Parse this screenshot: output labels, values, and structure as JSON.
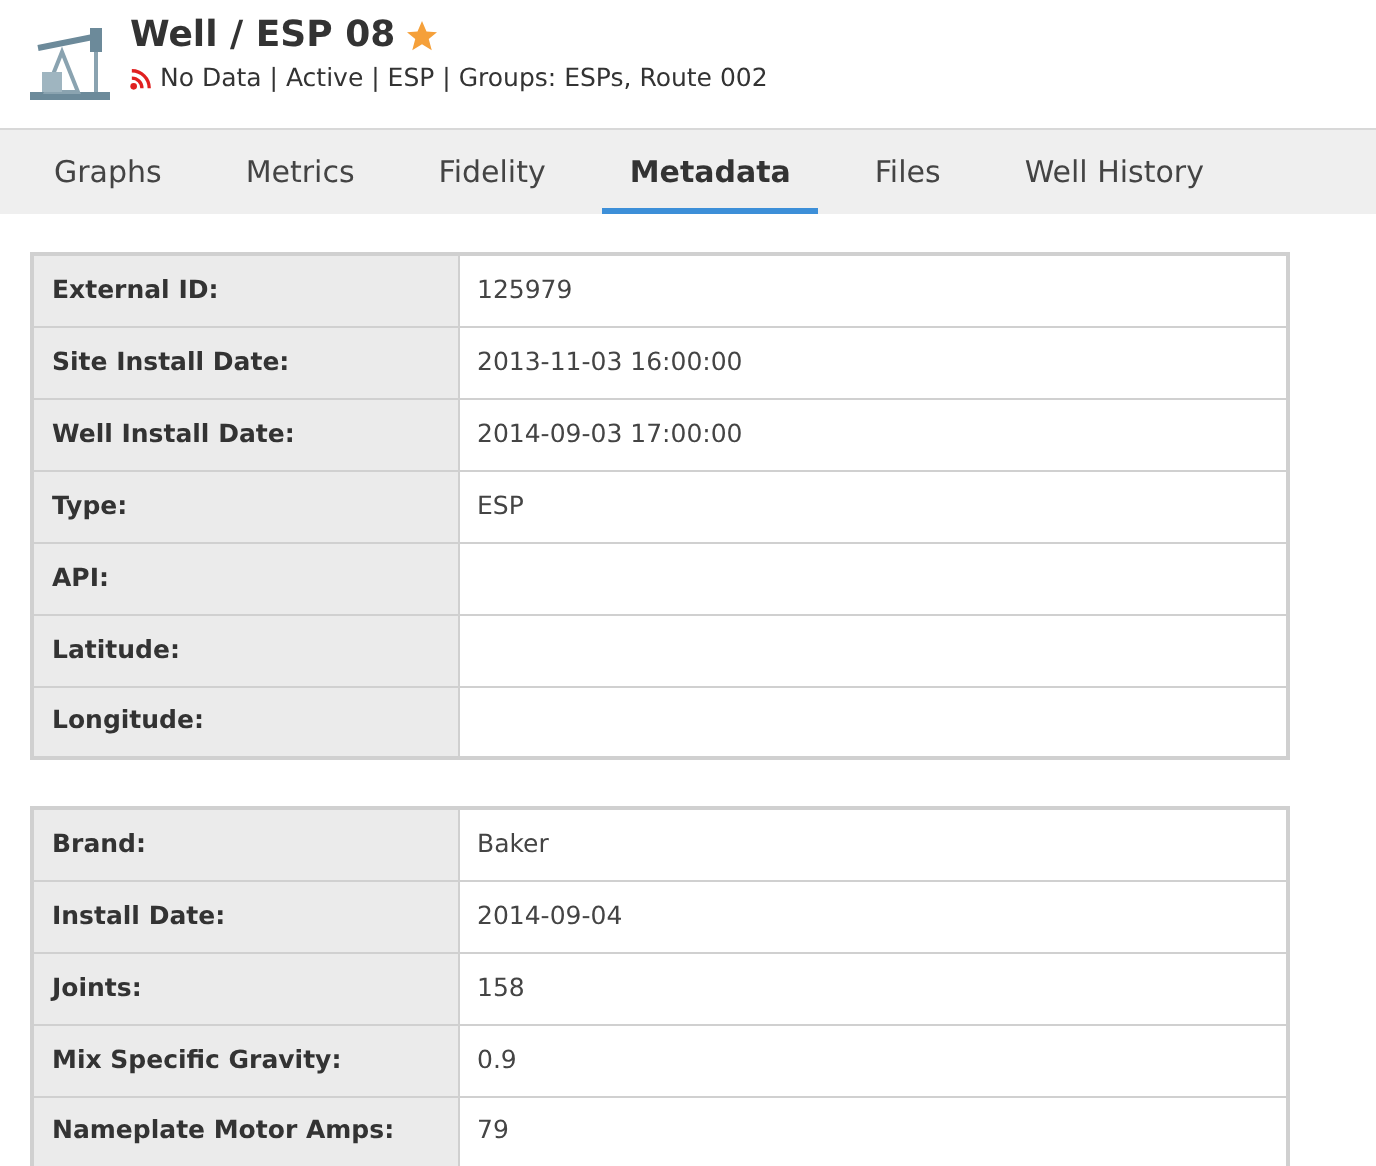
{
  "header": {
    "title": "Well / ESP 08",
    "favorite": true,
    "status": "No Data | Active | ESP | Groups: ESPs, Route 002"
  },
  "tabs": [
    {
      "label": "Graphs",
      "selected": false
    },
    {
      "label": "Metrics",
      "selected": false
    },
    {
      "label": "Fidelity",
      "selected": false
    },
    {
      "label": "Metadata",
      "selected": true
    },
    {
      "label": "Files",
      "selected": false
    },
    {
      "label": "Well History",
      "selected": false
    }
  ],
  "tables": [
    {
      "rows": [
        {
          "label": "External ID:",
          "value": "125979"
        },
        {
          "label": "Site Install Date:",
          "value": "2013-11-03 16:00:00"
        },
        {
          "label": "Well Install Date:",
          "value": "2014-09-03 17:00:00"
        },
        {
          "label": "Type:",
          "value": "ESP"
        },
        {
          "label": "API:"
        },
        {
          "label": "Latitude:"
        },
        {
          "label": "Longitude:"
        }
      ]
    },
    {
      "rows": [
        {
          "label": "Brand:",
          "value": "Baker"
        },
        {
          "label": "Install Date:",
          "value": "2014-09-04"
        },
        {
          "label": "Joints:",
          "value": "158"
        },
        {
          "label": "Mix Specific Gravity:",
          "value": "0.9"
        },
        {
          "label": "Nameplate Motor Amps:",
          "value": "79"
        }
      ]
    }
  ]
}
